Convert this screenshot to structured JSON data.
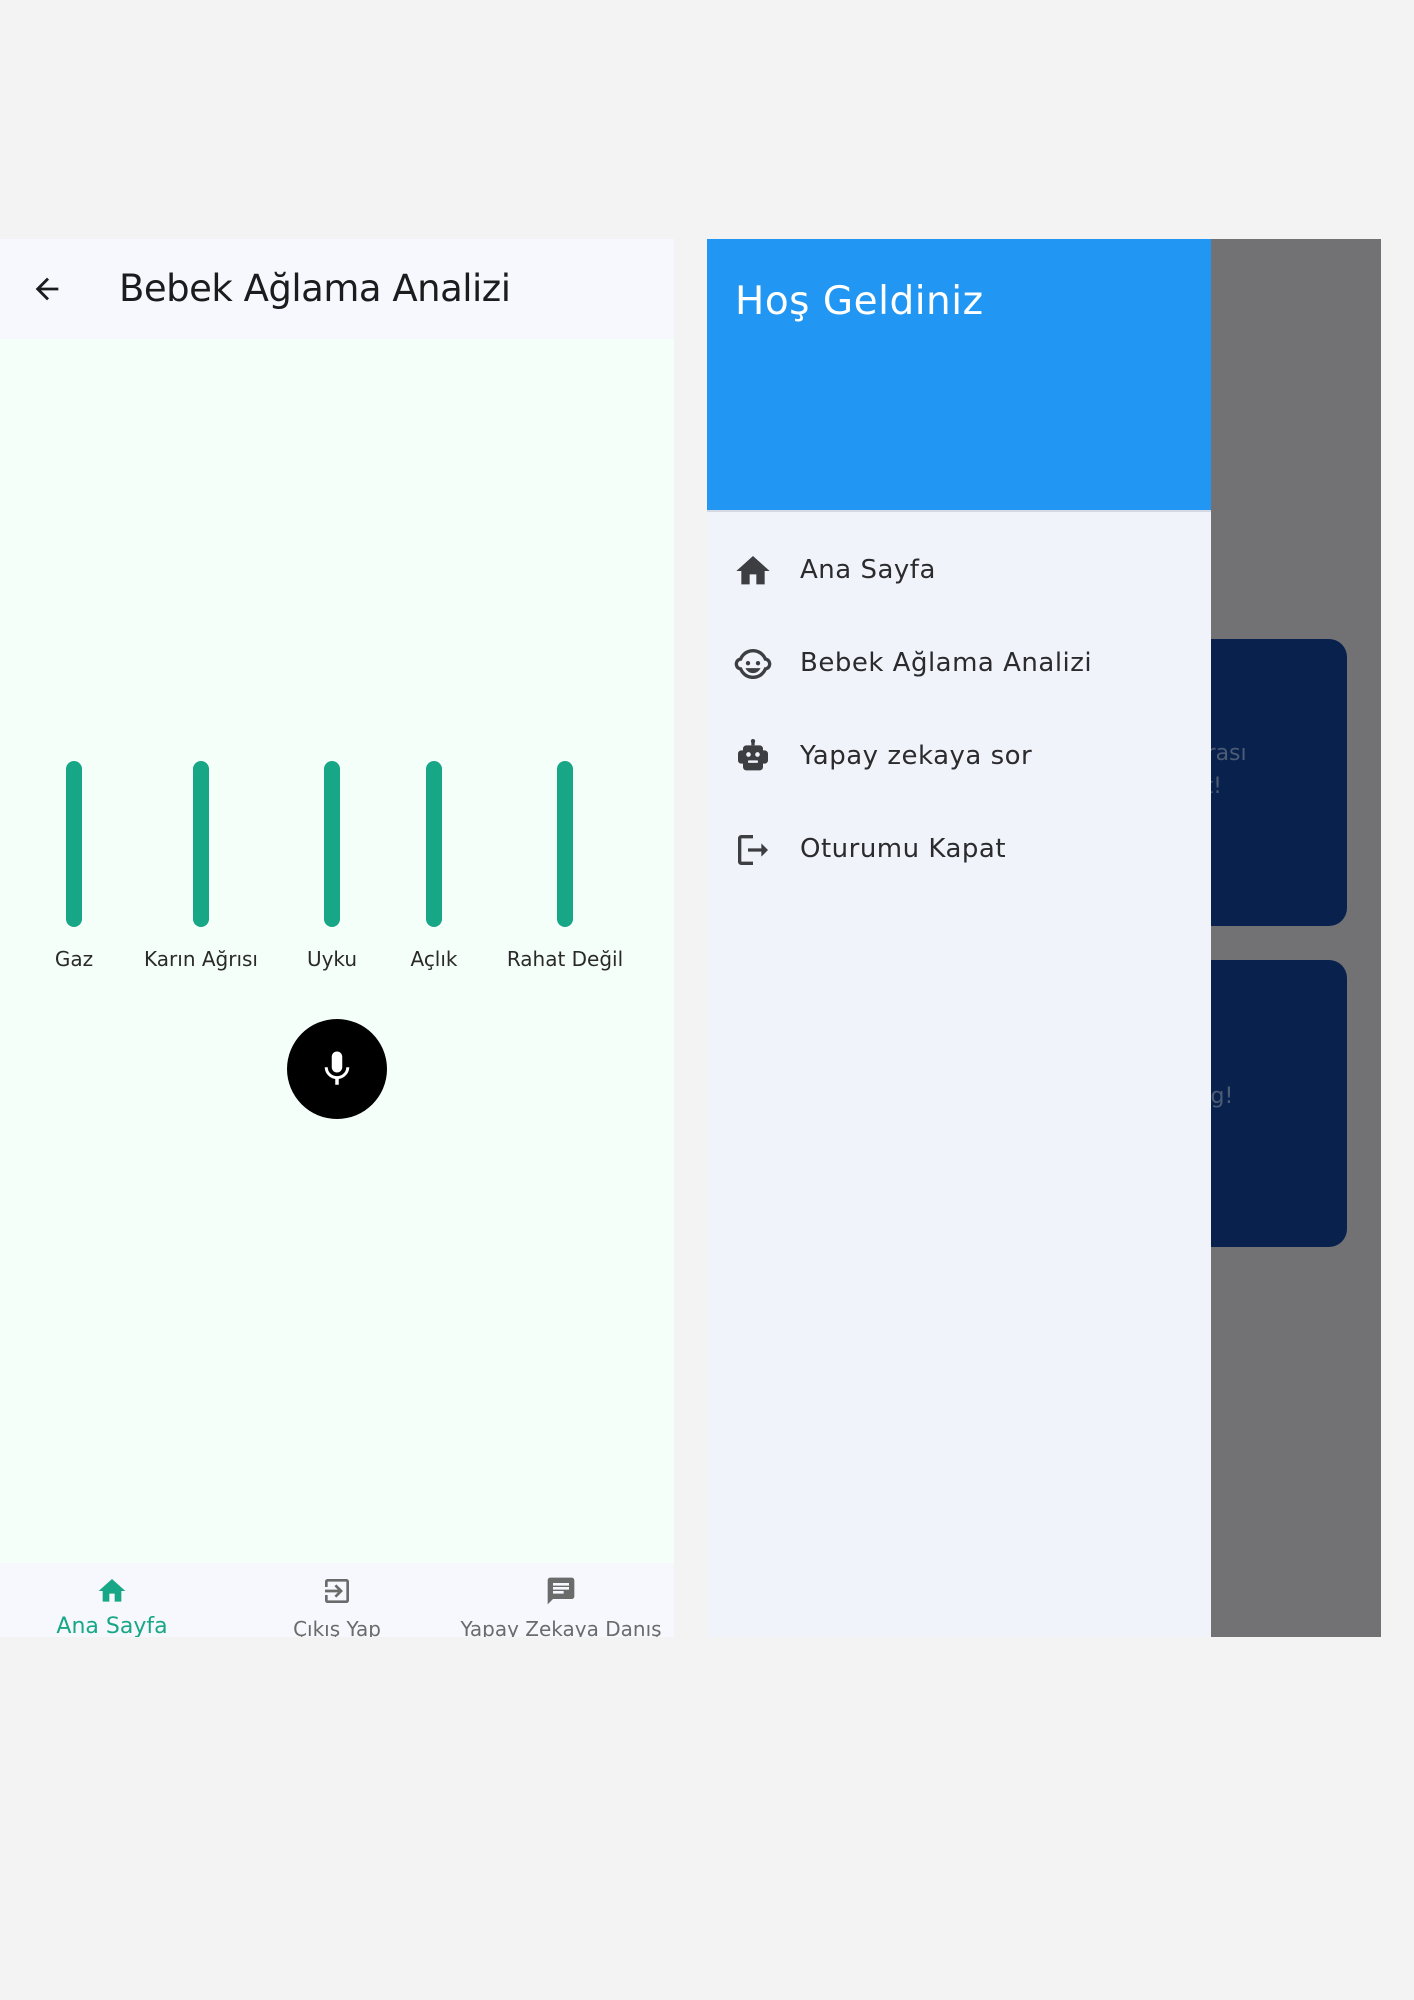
{
  "left_screen": {
    "app_bar": {
      "title": "Bebek Ağlama Analizi",
      "back_icon": "arrow-back-icon"
    },
    "analysis_bars": [
      {
        "label": "Gaz",
        "level": 1.0
      },
      {
        "label": "Karın Ağrısı",
        "level": 1.0
      },
      {
        "label": "Uyku",
        "level": 1.0
      },
      {
        "label": "Açlık",
        "level": 1.0
      },
      {
        "label": "Rahat Değil",
        "level": 1.0
      }
    ],
    "mic_button": {
      "icon": "mic-icon"
    },
    "bottom_nav": [
      {
        "label": "Ana Sayfa",
        "icon": "home-icon",
        "active": true
      },
      {
        "label": "Çıkış Yap",
        "icon": "exit-icon",
        "active": false
      },
      {
        "label": "Yapay Zekaya Danış",
        "icon": "chat-icon",
        "active": false
      }
    ]
  },
  "right_screen": {
    "drawer": {
      "header_title": "Hoş Geldiniz",
      "items": [
        {
          "label": "Ana Sayfa",
          "icon": "home-icon"
        },
        {
          "label": "Bebek Ağlama Analizi",
          "icon": "baby-face-icon"
        },
        {
          "label": "Yapay zekaya sor",
          "icon": "robot-icon"
        },
        {
          "label": "Oturumu Kapat",
          "icon": "logout-icon"
        }
      ]
    },
    "background_cards": [
      {
        "lines": [
          "r arası",
          "bet!"
        ]
      },
      {
        "lines": [
          "blog!"
        ]
      }
    ]
  },
  "colors": {
    "accent": "#17a686",
    "drawer_header": "#2196f2",
    "card": "#08224d",
    "scrim": "#727274"
  }
}
